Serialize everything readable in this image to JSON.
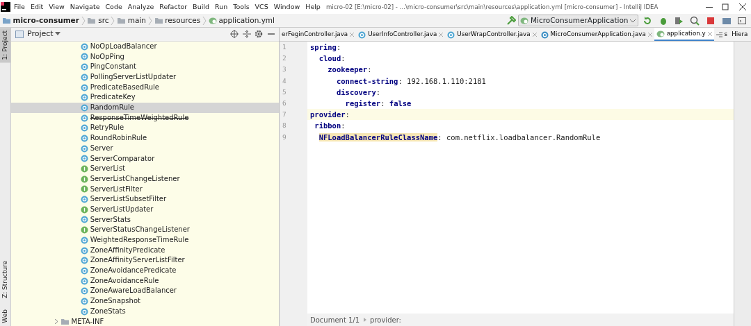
{
  "window": {
    "title": "micro-02 [E:\\micro-02] - ...\\micro-consumer\\src\\main\\resources\\application.yml [micro-consumer] - IntelliJ IDEA"
  },
  "menu": [
    "File",
    "Edit",
    "View",
    "Navigate",
    "Code",
    "Analyze",
    "Refactor",
    "Build",
    "Run",
    "Tools",
    "VCS",
    "Window",
    "Help"
  ],
  "breadcrumb": [
    {
      "label": "micro-consumer",
      "kind": "module"
    },
    {
      "label": "src",
      "kind": "folder"
    },
    {
      "label": "main",
      "kind": "folder"
    },
    {
      "label": "resources",
      "kind": "resources"
    },
    {
      "label": "application.yml",
      "kind": "yaml"
    }
  ],
  "run_config": "MicroConsumerApplication",
  "left_stripe": [
    {
      "label": "1: Project",
      "selected": true
    },
    {
      "label": "Z: Structure",
      "selected": false
    },
    {
      "label": "Web",
      "selected": false
    }
  ],
  "project_panel": {
    "title": "Project",
    "items": [
      {
        "label": "NoOpLoadBalancer",
        "kind": "class",
        "deprecated": false,
        "selected": false
      },
      {
        "label": "NoOpPing",
        "kind": "class",
        "deprecated": false,
        "selected": false
      },
      {
        "label": "PingConstant",
        "kind": "class",
        "deprecated": false,
        "selected": false
      },
      {
        "label": "PollingServerListUpdater",
        "kind": "class",
        "deprecated": false,
        "selected": false
      },
      {
        "label": "PredicateBasedRule",
        "kind": "class",
        "deprecated": false,
        "selected": false
      },
      {
        "label": "PredicateKey",
        "kind": "class",
        "deprecated": false,
        "selected": false
      },
      {
        "label": "RandomRule",
        "kind": "class",
        "deprecated": false,
        "selected": true
      },
      {
        "label": "ResponseTimeWeightedRule",
        "kind": "class",
        "deprecated": true,
        "selected": false
      },
      {
        "label": "RetryRule",
        "kind": "class",
        "deprecated": false,
        "selected": false
      },
      {
        "label": "RoundRobinRule",
        "kind": "class",
        "deprecated": false,
        "selected": false
      },
      {
        "label": "Server",
        "kind": "class",
        "deprecated": false,
        "selected": false
      },
      {
        "label": "ServerComparator",
        "kind": "class",
        "deprecated": false,
        "selected": false
      },
      {
        "label": "ServerList",
        "kind": "interface",
        "deprecated": false,
        "selected": false
      },
      {
        "label": "ServerListChangeListener",
        "kind": "interface",
        "deprecated": false,
        "selected": false
      },
      {
        "label": "ServerListFilter",
        "kind": "interface",
        "deprecated": false,
        "selected": false
      },
      {
        "label": "ServerListSubsetFilter",
        "kind": "class",
        "deprecated": false,
        "selected": false
      },
      {
        "label": "ServerListUpdater",
        "kind": "interface",
        "deprecated": false,
        "selected": false
      },
      {
        "label": "ServerStats",
        "kind": "class",
        "deprecated": false,
        "selected": false
      },
      {
        "label": "ServerStatusChangeListener",
        "kind": "interface",
        "deprecated": false,
        "selected": false
      },
      {
        "label": "WeightedResponseTimeRule",
        "kind": "class",
        "deprecated": false,
        "selected": false
      },
      {
        "label": "ZoneAffinityPredicate",
        "kind": "class",
        "deprecated": false,
        "selected": false
      },
      {
        "label": "ZoneAffinityServerListFilter",
        "kind": "class",
        "deprecated": false,
        "selected": false
      },
      {
        "label": "ZoneAvoidancePredicate",
        "kind": "class",
        "deprecated": false,
        "selected": false
      },
      {
        "label": "ZoneAvoidanceRule",
        "kind": "class",
        "deprecated": false,
        "selected": false
      },
      {
        "label": "ZoneAwareLoadBalancer",
        "kind": "class",
        "deprecated": false,
        "selected": false
      },
      {
        "label": "ZoneSnapshot",
        "kind": "class",
        "deprecated": false,
        "selected": false
      },
      {
        "label": "ZoneStats",
        "kind": "class",
        "deprecated": false,
        "selected": false
      },
      {
        "label": "META-INF",
        "kind": "folder",
        "deprecated": false,
        "selected": false
      }
    ]
  },
  "tabs": [
    {
      "label": "erFeginController.java",
      "selected": false
    },
    {
      "label": "UserInfoController.java",
      "kind": "class",
      "selected": false
    },
    {
      "label": "UserWrapController.java",
      "kind": "class",
      "selected": false
    },
    {
      "label": "MicroConsumerApplication.java",
      "kind": "app",
      "selected": false
    },
    {
      "label": "application.y",
      "kind": "yaml",
      "selected": true
    }
  ],
  "tab_overflow": "s",
  "right_tab": "Hiera",
  "editor": {
    "lines": [
      {
        "number": "1",
        "key": "spring",
        "sep": ":",
        "current": false,
        "key_highlighted": false
      },
      {
        "number": "2",
        "key": "  cloud",
        "sep": ":",
        "current": false,
        "key_highlighted": false
      },
      {
        "number": "3",
        "key": "    zookeeper",
        "sep": ":",
        "current": false,
        "key_highlighted": false
      },
      {
        "number": "4",
        "key": "      connect-string",
        "sep": ":",
        "value": "192.168.1.110:2181",
        "value_keyword": false,
        "current": false,
        "key_highlighted": false
      },
      {
        "number": "5",
        "key": "      discovery",
        "sep": ":",
        "current": false,
        "key_highlighted": false
      },
      {
        "number": "6",
        "key": "        register",
        "sep": ":",
        "value": "false",
        "value_keyword": true,
        "current": false,
        "key_highlighted": false
      },
      {
        "number": "7",
        "key": "provider",
        "sep": ":",
        "current": true,
        "key_highlighted": false
      },
      {
        "number": "8",
        "key": " ribbon",
        "sep": ":",
        "current": false,
        "key_highlighted": false
      },
      {
        "number": "9",
        "key": "  NFLoadBalancerRuleClassName",
        "sep": ":",
        "value": "com.netflix.loadbalancer.RandomRule",
        "value_keyword": false,
        "current": false,
        "key_highlighted": true
      }
    ]
  },
  "status": {
    "document": "Document 1/1",
    "path": "provider:"
  }
}
